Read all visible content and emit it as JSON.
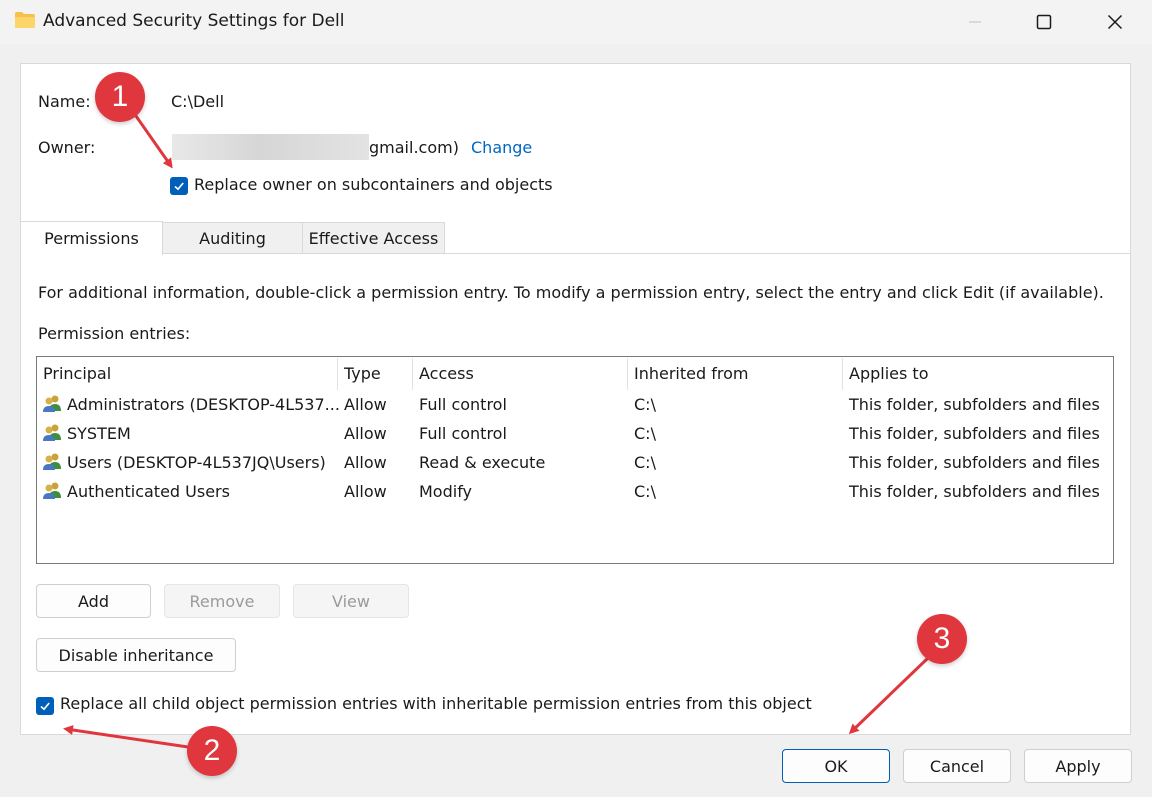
{
  "window": {
    "title": "Advanced Security Settings for Dell",
    "icons": [
      "folder-icon",
      "minimize-icon",
      "maximize-icon",
      "close-icon"
    ]
  },
  "info": {
    "name_label": "Name:",
    "name_value": "C:\\Dell",
    "owner_label": "Owner:",
    "owner_value_visible": "gmail.com)",
    "change_link": "Change",
    "replace_owner_label": "Replace owner on subcontainers and objects",
    "replace_owner_checked": true
  },
  "tabs": [
    {
      "label": "Permissions",
      "active": true
    },
    {
      "label": "Auditing",
      "active": false
    },
    {
      "label": "Effective Access",
      "active": false
    }
  ],
  "permissions": {
    "info_text": "For additional information, double-click a permission entry. To modify a permission entry, select the entry and click Edit (if available).",
    "entries_label": "Permission entries:",
    "columns": [
      "Principal",
      "Type",
      "Access",
      "Inherited from",
      "Applies to"
    ],
    "rows": [
      {
        "principal": "Administrators (DESKTOP-4L537...",
        "type": "Allow",
        "access": "Full control",
        "inherited": "C:\\",
        "applies": "This folder, subfolders and files"
      },
      {
        "principal": "SYSTEM",
        "type": "Allow",
        "access": "Full control",
        "inherited": "C:\\",
        "applies": "This folder, subfolders and files"
      },
      {
        "principal": "Users (DESKTOP-4L537JQ\\Users)",
        "type": "Allow",
        "access": "Read & execute",
        "inherited": "C:\\",
        "applies": "This folder, subfolders and files"
      },
      {
        "principal": "Authenticated Users",
        "type": "Allow",
        "access": "Modify",
        "inherited": "C:\\",
        "applies": "This folder, subfolders and files"
      }
    ],
    "buttons": {
      "add": "Add",
      "remove": "Remove",
      "view": "View",
      "disable_inheritance": "Disable inheritance"
    },
    "replace_child_label": "Replace all child object permission entries with inheritable permission entries from this object",
    "replace_child_checked": true
  },
  "footer": {
    "ok": "OK",
    "cancel": "Cancel",
    "apply": "Apply"
  },
  "annotations": [
    {
      "number": "1"
    },
    {
      "number": "2"
    },
    {
      "number": "3"
    }
  ],
  "colors": {
    "accent": "#005fb8",
    "link": "#0067c0",
    "annotation": "#e0363d"
  }
}
